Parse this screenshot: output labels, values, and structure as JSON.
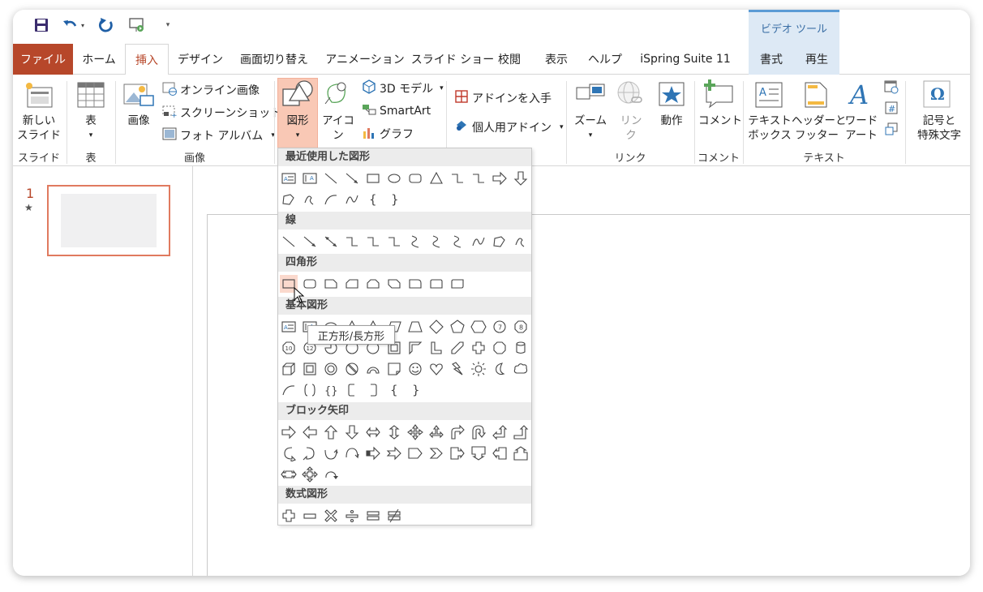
{
  "title_bar": {
    "quick_access": [
      "save-icon",
      "undo-icon",
      "redo-icon",
      "present-icon",
      "customize-icon"
    ],
    "context_group": "ビデオ ツール"
  },
  "tabs": [
    "ファイル",
    "ホーム",
    "挿入",
    "デザイン",
    "画面切り替え",
    "アニメーション",
    "スライド ショー",
    "校閲",
    "表示",
    "ヘルプ",
    "iSpring Suite 11",
    "書式",
    "再生"
  ],
  "ribbon": {
    "new_slide": "新しい\nスライド",
    "table": "表",
    "image": "画像",
    "online_image": "オンライン画像",
    "screenshot": "スクリーンショット",
    "photo_album": "フォト アルバム",
    "shapes": "図形",
    "icons": "アイコン",
    "model_3d": "3D モデル",
    "smartart": "SmartArt",
    "graph": "グラフ",
    "get_addins": "アドインを入手",
    "my_addins": "個人用アドイン",
    "zoom": "ズーム",
    "link": "リン\nク",
    "action": "動作",
    "comment": "コメント",
    "textbox": "テキスト\nボックス",
    "header_footer": "ヘッダーと\nフッター",
    "wordart": "ワード\nアート",
    "symbols": "記号と\n特殊文字",
    "groups": {
      "slide": "スライド",
      "table": "表",
      "image": "画像",
      "link": "リンク",
      "comment": "コメント",
      "text": "テキスト"
    }
  },
  "slides_pane": {
    "slide_number": "1",
    "star": "★"
  },
  "shapes_menu": {
    "categories": [
      "最近使用した図形",
      "線",
      "四角形",
      "基本図形",
      "ブロック矢印",
      "数式図形"
    ],
    "tooltip": "正方形/長方形"
  }
}
